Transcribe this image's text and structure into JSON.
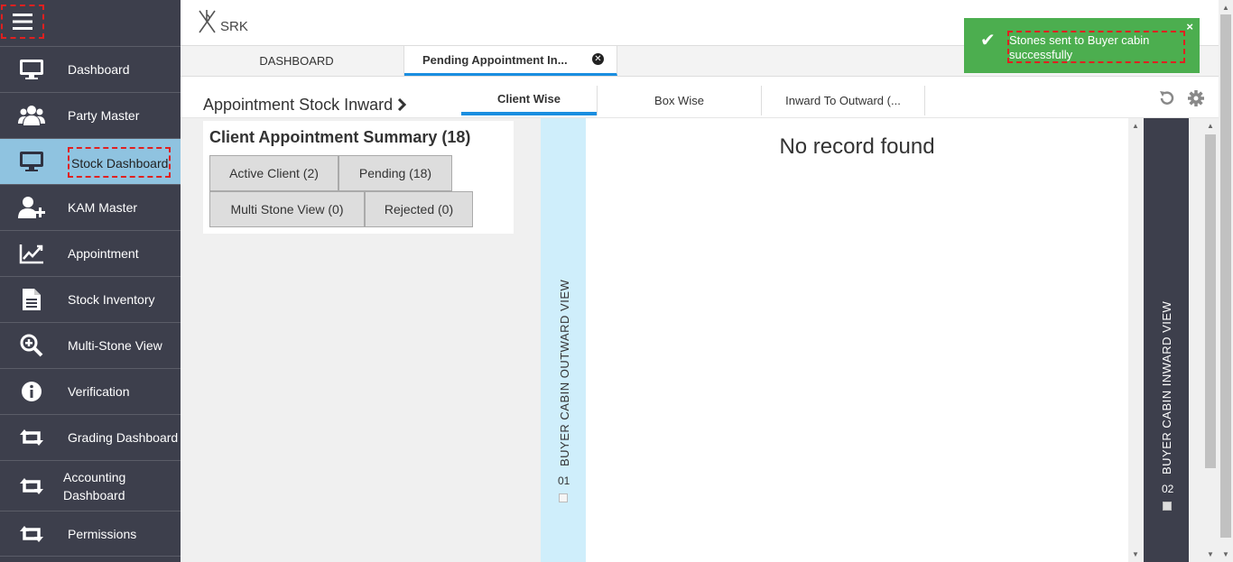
{
  "app": {
    "logo_text": "SRK"
  },
  "sidebar": {
    "items": [
      {
        "label": "Dashboard",
        "icon": "monitor-icon"
      },
      {
        "label": "Party Master",
        "icon": "users-icon"
      },
      {
        "label": "Stock Dashboard",
        "icon": "monitor-icon",
        "active": true
      },
      {
        "label": "KAM Master",
        "icon": "user-plus-icon"
      },
      {
        "label": "Appointment",
        "icon": "line-chart-icon"
      },
      {
        "label": "Stock Inventory",
        "icon": "document-icon"
      },
      {
        "label": "Multi-Stone View",
        "icon": "zoom-in-icon"
      },
      {
        "label": "Verification",
        "icon": "info-icon"
      },
      {
        "label": "Grading Dashboard",
        "icon": "retweet-icon"
      },
      {
        "label": "Accounting Dashboard",
        "icon": "retweet-icon"
      },
      {
        "label": "Permissions",
        "icon": "retweet-icon"
      }
    ]
  },
  "tabs": {
    "dashboard": "DASHBOARD",
    "active": "Pending Appointment In..."
  },
  "toast": {
    "message": "Stones sent to Buyer cabin successfully",
    "close": "×"
  },
  "header": {
    "title": "Appointment Stock Inward"
  },
  "subtabs": {
    "client_wise": "Client Wise",
    "box_wise": "Box Wise",
    "inward_to_outward": "Inward To Outward (..."
  },
  "summary": {
    "title": "Client Appointment Summary (18)",
    "buttons": {
      "active_client": "Active Client (2)",
      "pending": "Pending (18)",
      "multi_stone": "Multi Stone View (0)",
      "rejected": "Rejected (0)"
    }
  },
  "outward": {
    "label": "BUYER CABIN OUTWARD VIEW",
    "number": "01"
  },
  "records": {
    "empty": "No record found"
  },
  "inward": {
    "label": "BUYER CABIN INWARD VIEW",
    "number": "02"
  },
  "colors": {
    "sidebar": "#3d3f4c",
    "active": "#8fc3e0",
    "accent": "#1a8ee0",
    "toast": "#4cae4f"
  }
}
